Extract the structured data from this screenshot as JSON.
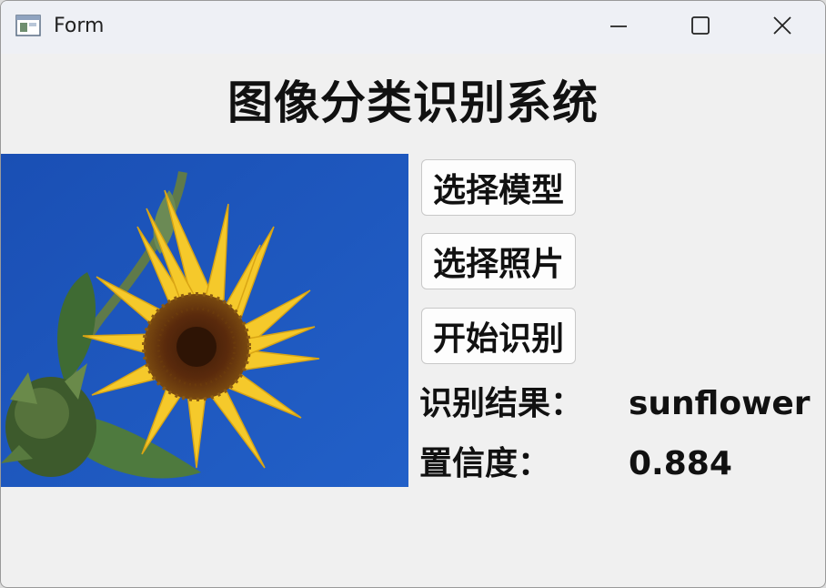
{
  "window": {
    "title": "Form",
    "icons": {
      "app": "app-form-icon",
      "minimize": "minimize-icon",
      "maximize": "maximize-icon",
      "close": "close-icon"
    }
  },
  "main": {
    "heading": "图像分类识别系统",
    "image": {
      "subject": "sunflower against blue sky",
      "background_color": "#1d54b8",
      "petal_color": "#f5c92b"
    },
    "buttons": {
      "select_model": "选择模型",
      "select_photo": "选择照片",
      "start_recognition": "开始识别"
    },
    "result": {
      "label": "识别结果：",
      "value": "sunflower"
    },
    "confidence": {
      "label": "置信度：",
      "value": "0.884"
    }
  }
}
